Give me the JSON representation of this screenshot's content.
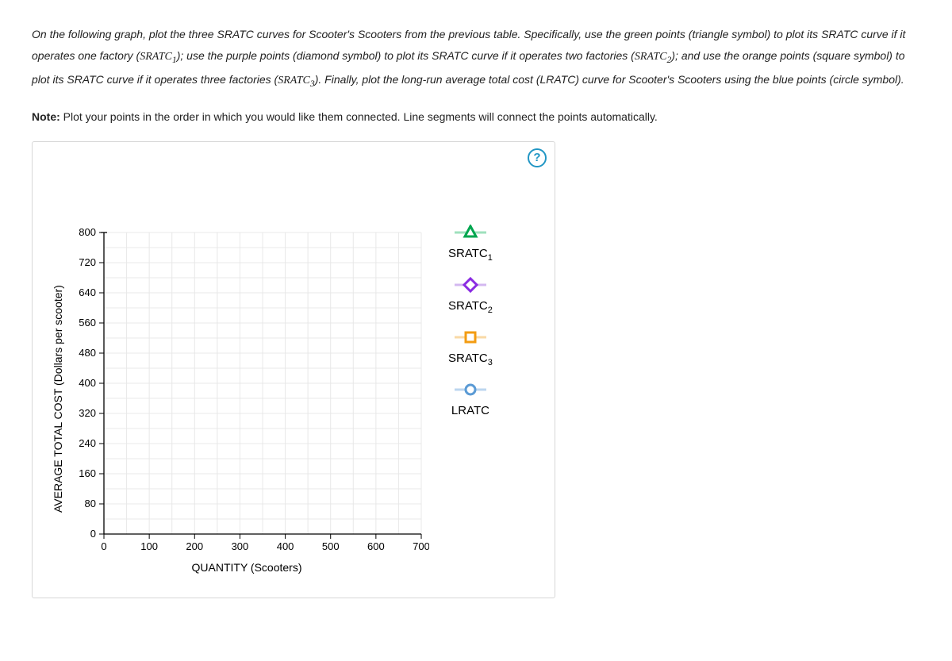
{
  "instructions": {
    "p1a": "On the following graph, plot the three SRATC curves for Scooter's Scooters from the previous table. Specifically, use the green points (triangle symbol) to plot its SRATC curve if it operates one factory (",
    "var1": "SRATC",
    "sub1": "1",
    "p1b": "); use the purple points (diamond symbol) to plot its SRATC curve if it operates two factories (",
    "var2": "SRATC",
    "sub2": "2",
    "p1c": "); and use the orange points (square symbol) to plot its SRATC curve if it operates three factories (",
    "var3": "SRATC",
    "sub3": "3",
    "p1d": "). Finally, plot the long-run average total cost (LRATC) curve for Scooter's Scooters using the blue points (circle symbol)."
  },
  "note": {
    "label": "Note:",
    "text": " Plot your points in the order in which you would like them connected. Line segments will connect the points automatically."
  },
  "help": "?",
  "chart_data": {
    "type": "scatter",
    "title": "",
    "xlabel": "QUANTITY (Scooters)",
    "ylabel": "AVERAGE TOTAL COST (Dollars per scooter)",
    "xlim": [
      0,
      700
    ],
    "ylim": [
      0,
      800
    ],
    "xticks": [
      0,
      100,
      200,
      300,
      400,
      500,
      600,
      700
    ],
    "yticks": [
      0,
      80,
      160,
      240,
      320,
      400,
      480,
      560,
      640,
      720,
      800
    ],
    "series": [
      {
        "name": "SRATC1",
        "marker": "triangle",
        "color": "#00a64f",
        "values": []
      },
      {
        "name": "SRATC2",
        "marker": "diamond",
        "color": "#8a2be2",
        "values": []
      },
      {
        "name": "SRATC3",
        "marker": "square",
        "color": "#f39c12",
        "values": []
      },
      {
        "name": "LRATC",
        "marker": "circle",
        "color": "#5b9bd5",
        "values": []
      }
    ]
  },
  "palette": {
    "items": [
      {
        "base": "SRATC",
        "sub": "1"
      },
      {
        "base": "SRATC",
        "sub": "2"
      },
      {
        "base": "SRATC",
        "sub": "3"
      },
      {
        "base": "LRATC",
        "sub": ""
      }
    ]
  }
}
